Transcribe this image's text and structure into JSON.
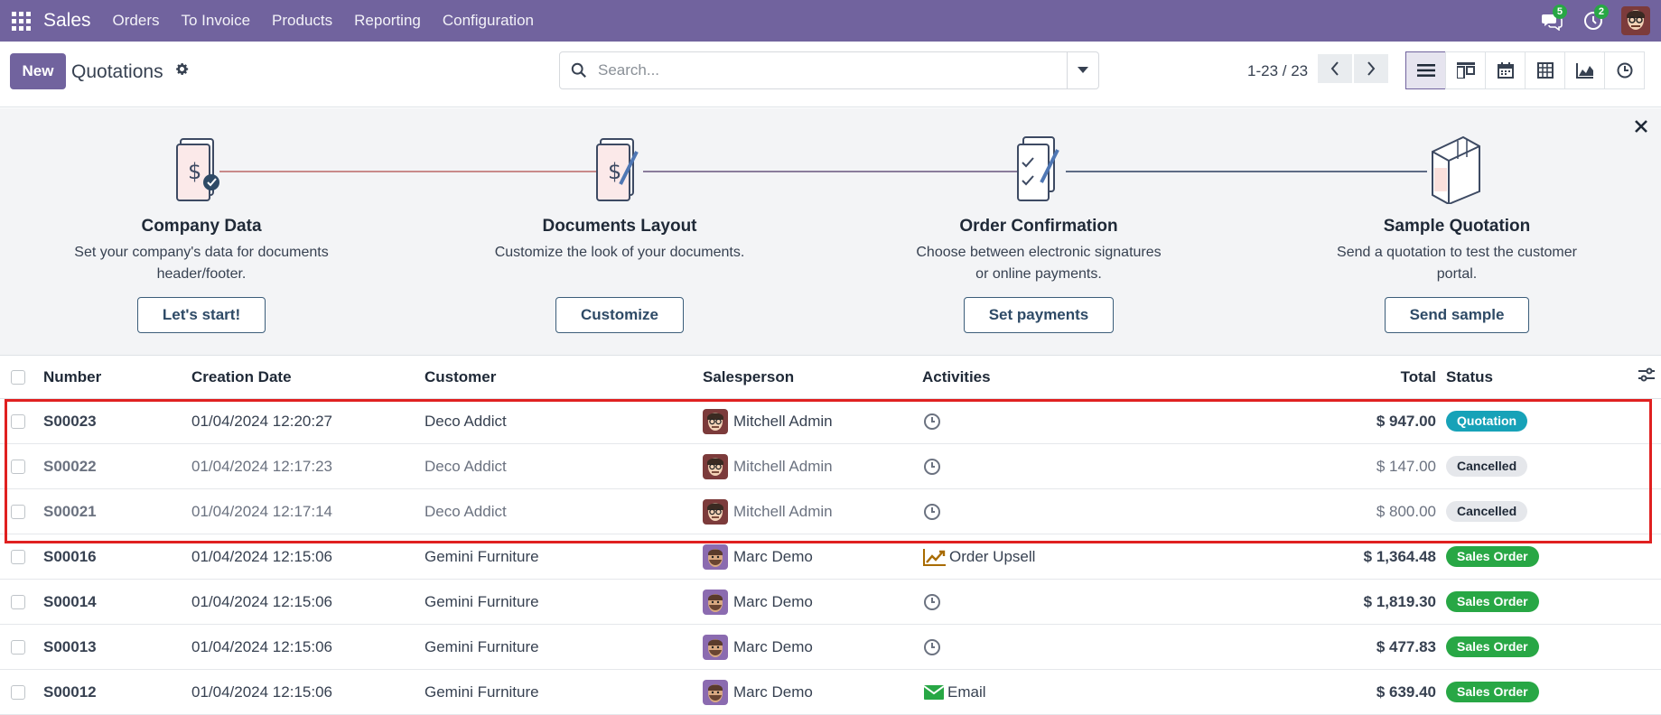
{
  "nav": {
    "brand": "Sales",
    "menu": [
      "Orders",
      "To Invoice",
      "Products",
      "Reporting",
      "Configuration"
    ],
    "messages_count": "5",
    "activities_count": "2",
    "colors": {
      "primary": "#71639e",
      "badge": "#28a745"
    }
  },
  "control": {
    "new_label": "New",
    "title": "Quotations",
    "search_placeholder": "Search...",
    "pager": "1-23 / 23",
    "views": [
      "list-view-icon",
      "kanban-view-icon",
      "calendar-view-icon",
      "pivot-view-icon",
      "graph-view-icon",
      "activity-view-icon"
    ]
  },
  "onboarding": {
    "steps": [
      {
        "title": "Company Data",
        "desc1": "Set your company's data for documents",
        "desc2": "header/footer.",
        "button": "Let's start!"
      },
      {
        "title": "Documents Layout",
        "desc1": "Customize the look of your documents.",
        "desc2": "",
        "button": "Customize"
      },
      {
        "title": "Order Confirmation",
        "desc1": "Choose between electronic signatures",
        "desc2": "or online payments.",
        "button": "Set payments"
      },
      {
        "title": "Sample Quotation",
        "desc1": "Send a quotation to test the customer",
        "desc2": "portal.",
        "button": "Send sample"
      }
    ]
  },
  "table": {
    "headers": {
      "number": "Number",
      "date": "Creation Date",
      "customer": "Customer",
      "salesperson": "Salesperson",
      "activities": "Activities",
      "total": "Total",
      "status": "Status"
    },
    "rows": [
      {
        "number": "S00023",
        "date": "01/04/2024 12:20:27",
        "customer": "Deco Addict",
        "salesperson": "Mitchell Admin",
        "activity": "",
        "activity_icon": "clock-icon",
        "total": "$ 947.00",
        "status": "Quotation"
      },
      {
        "number": "S00022",
        "date": "01/04/2024 12:17:23",
        "customer": "Deco Addict",
        "salesperson": "Mitchell Admin",
        "activity": "",
        "activity_icon": "clock-icon",
        "total": "$ 147.00",
        "status": "Cancelled"
      },
      {
        "number": "S00021",
        "date": "01/04/2024 12:17:14",
        "customer": "Deco Addict",
        "salesperson": "Mitchell Admin",
        "activity": "",
        "activity_icon": "clock-icon",
        "total": "$ 800.00",
        "status": "Cancelled"
      },
      {
        "number": "S00016",
        "date": "01/04/2024 12:15:06",
        "customer": "Gemini Furniture",
        "salesperson": "Marc Demo",
        "activity": "Order Upsell",
        "activity_icon": "upsell-chart-icon",
        "total": "$ 1,364.48",
        "status": "Sales Order"
      },
      {
        "number": "S00014",
        "date": "01/04/2024 12:15:06",
        "customer": "Gemini Furniture",
        "salesperson": "Marc Demo",
        "activity": "",
        "activity_icon": "clock-icon",
        "total": "$ 1,819.30",
        "status": "Sales Order"
      },
      {
        "number": "S00013",
        "date": "01/04/2024 12:15:06",
        "customer": "Gemini Furniture",
        "salesperson": "Marc Demo",
        "activity": "",
        "activity_icon": "clock-icon",
        "total": "$ 477.83",
        "status": "Sales Order"
      },
      {
        "number": "S00012",
        "date": "01/04/2024 12:15:06",
        "customer": "Gemini Furniture",
        "salesperson": "Marc Demo",
        "activity": "Email",
        "activity_icon": "email-icon",
        "total": "$ 639.40",
        "status": "Sales Order"
      }
    ]
  }
}
